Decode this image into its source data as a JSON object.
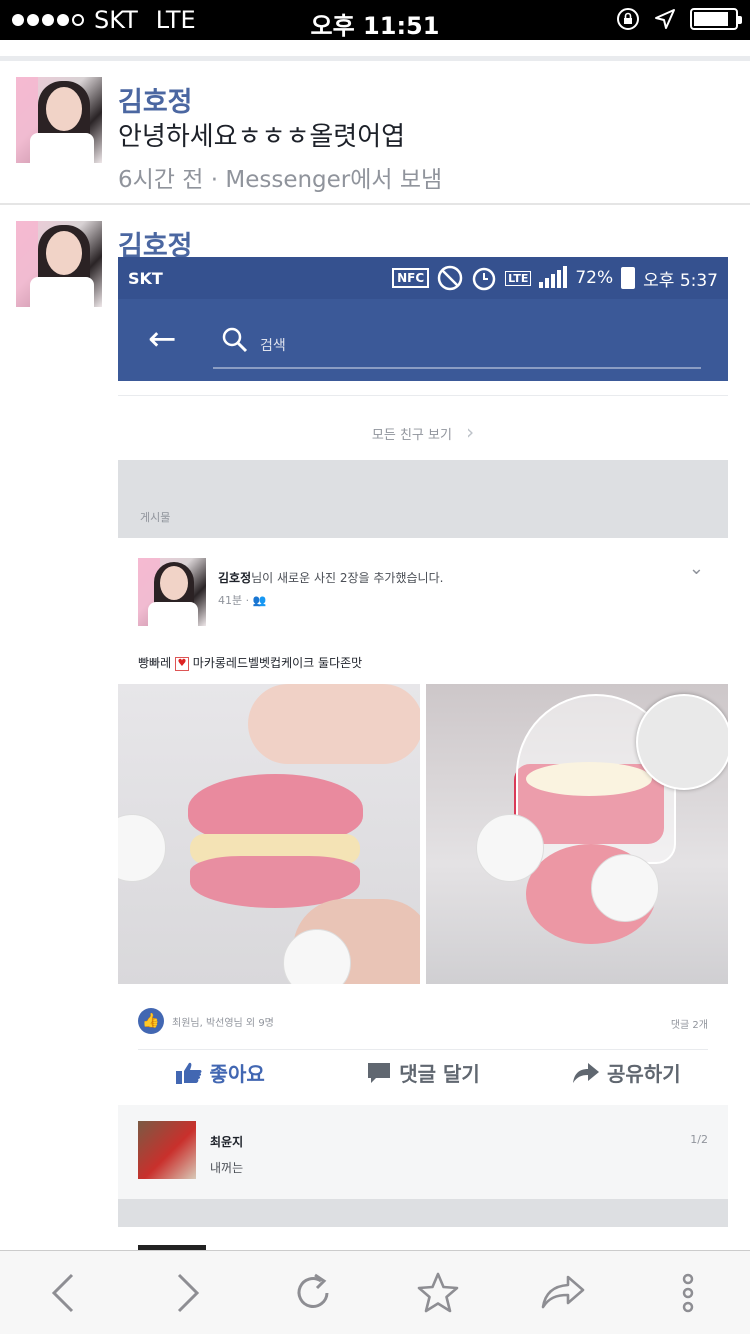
{
  "statusbar": {
    "carrier": "SKT",
    "network": "LTE",
    "time": "오후 11:51"
  },
  "thread1": {
    "name": "김호정",
    "message": "안녕하세요ㅎㅎㅎ올렷어엽",
    "meta": "6시간 전 · Messenger에서 보냄"
  },
  "thread2": {
    "name": "김호정"
  },
  "shot": {
    "status": {
      "carrier": "SKT",
      "nfc": "NFC",
      "battery": "72%",
      "time": "오후 5:37"
    },
    "search_label": "검색",
    "see_all_friends": "모든 친구 보기",
    "section_title": "게시물",
    "post": {
      "author": "김호정",
      "action": "님이 새로운 사진 2장을 추가했습니다.",
      "time": "41분 ·",
      "text_before": "빵빠레",
      "text_after": "마카롱레드벨벳컵케이크 둘다존맛",
      "likes": "최원님, 박선영님 외 9명",
      "comment_count": "댓글 2개",
      "actions": {
        "like": "좋아요",
        "comment": "댓글 달기",
        "share": "공유하기"
      }
    },
    "comment": {
      "name": "최윤지",
      "text": "내꺼는",
      "page": "1/2"
    }
  },
  "toolbar": {
    "items": [
      "back-icon",
      "forward-icon",
      "reload-icon",
      "bookmark-icon",
      "share-icon",
      "more-icon"
    ]
  }
}
